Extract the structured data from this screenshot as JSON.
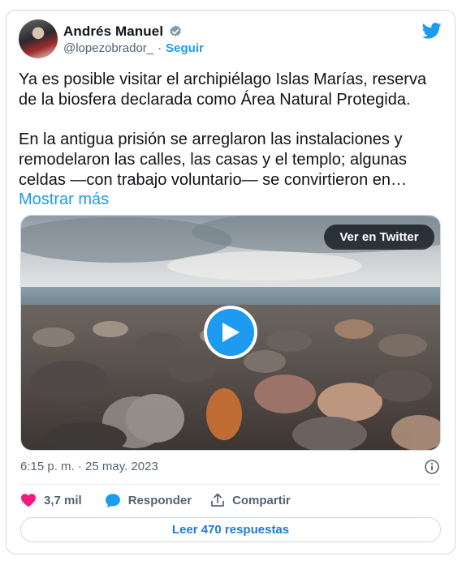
{
  "author": {
    "name": "Andrés Manuel",
    "handle": "@lopezobrador_",
    "separator": "·",
    "follow_label": "Seguir"
  },
  "tweet": {
    "text": "Ya es posible visitar el archipiélago Islas Marías, reserva de la biosfera declarada como Área Natural Protegida.\n\nEn la antigua prisión se arreglaron las instalaciones y remodelaron las calles, las casas y el templo; algunas celdas —con trabajo voluntario— se convirtieron en…",
    "show_more": "Mostrar más"
  },
  "media": {
    "view_on_twitter": "Ver en Twitter"
  },
  "timestamp": "6:15 p. m. · 25 may. 2023",
  "actions": {
    "likes": "3,7 mil",
    "reply": "Responder",
    "share": "Compartir"
  },
  "read_replies": "Leer 470 respuestas",
  "colors": {
    "brand": "#1d9bf0",
    "like": "#f91880",
    "muted": "#536471"
  },
  "icons": [
    "verified-badge-icon",
    "twitter-bird-icon",
    "play-icon",
    "info-icon",
    "heart-icon",
    "reply-bubble-icon",
    "share-icon"
  ]
}
